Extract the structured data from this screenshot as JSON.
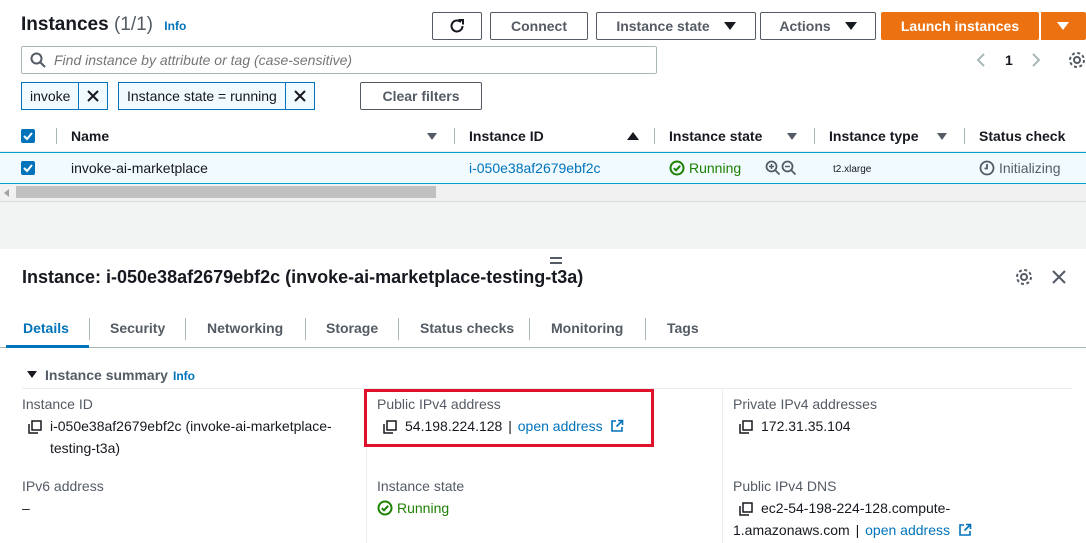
{
  "header": {
    "title": "Instances",
    "count": "(1/1)",
    "info": "Info",
    "connect_label": "Connect",
    "instance_state_label": "Instance state",
    "actions_label": "Actions",
    "launch_label": "Launch instances",
    "page_number": "1"
  },
  "search": {
    "placeholder": "Find instance by attribute or tag (case-sensitive)"
  },
  "filters": [
    {
      "label": "invoke"
    },
    {
      "label": "Instance state = running"
    }
  ],
  "clear_filters_label": "Clear filters",
  "table": {
    "columns": [
      "Name",
      "Instance ID",
      "Instance state",
      "Instance type",
      "Status check"
    ],
    "rows": [
      {
        "name": "invoke-ai-marketplace",
        "instance_id": "i-050e38af2679ebf2c",
        "state": "Running",
        "type": "t2.xlarge",
        "status": "Initializing"
      }
    ]
  },
  "detail": {
    "title": "Instance: i-050e38af2679ebf2c (invoke-ai-marketplace-testing-t3a)",
    "tabs": [
      "Details",
      "Security",
      "Networking",
      "Storage",
      "Status checks",
      "Monitoring",
      "Tags"
    ],
    "section_title": "Instance summary",
    "section_info": "Info",
    "fields": {
      "instance_id_label": "Instance ID",
      "instance_id_value_1": "i-050e38af2679ebf2c (invoke-ai-marketplace-",
      "instance_id_value_2": "testing-t3a)",
      "public_ipv4_label": "Public IPv4 address",
      "public_ipv4_value": "54.198.224.128",
      "open_address": "open address",
      "private_ipv4_label": "Private IPv4 addresses",
      "private_ipv4_value": "172.31.35.104",
      "ipv6_label": "IPv6 address",
      "ipv6_value": "–",
      "instance_state_label": "Instance state",
      "instance_state_value": "Running",
      "public_dns_label": "Public IPv4 DNS",
      "public_dns_value_1": "ec2-54-198-224-128.compute-",
      "public_dns_value_2": "1.amazonaws.com",
      "pipe": "|"
    }
  },
  "colors": {
    "accent": "#0073bb",
    "launch": "#ec7211",
    "success": "#1d8102",
    "highlight": "#e0112b"
  }
}
